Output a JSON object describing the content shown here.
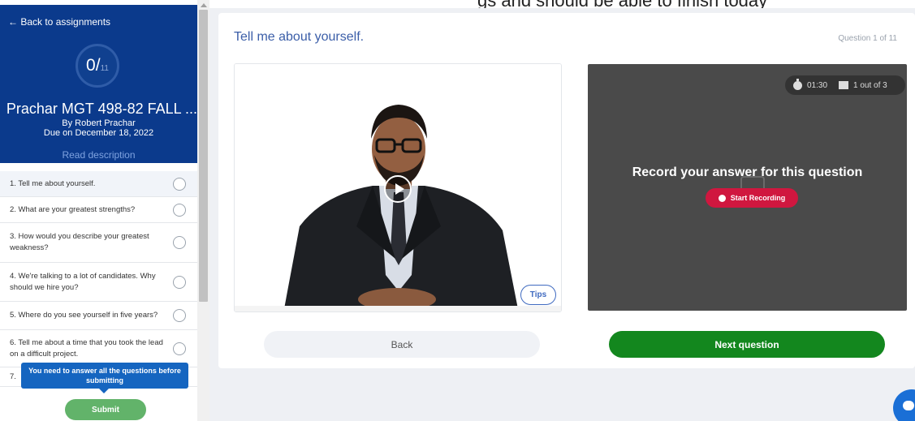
{
  "top_strip": {
    "partial_text": "gs and should be able to finish today"
  },
  "sidebar": {
    "back_link": "← Back to assignments",
    "progress": {
      "done": "0",
      "total": "11"
    },
    "course_title": "Prachar MGT 498-82 FALL ...",
    "author": "By Robert Prachar",
    "due": "Due on December 18, 2022",
    "read_description": "Read description",
    "questions": [
      {
        "label": "1. Tell me about yourself.",
        "active": true
      },
      {
        "label": "2. What are your greatest strengths?",
        "active": false
      },
      {
        "label": "3. How would you describe your greatest weakness?",
        "active": false
      },
      {
        "label": "4. We're talking to a lot of candidates. Why should we hire you?",
        "active": false
      },
      {
        "label": "5. Where do you see yourself in five years?",
        "active": false
      },
      {
        "label": "6. Tell me about a time that you took the lead on a difficult project.",
        "active": false
      },
      {
        "label": "7.",
        "active": false
      }
    ],
    "tooltip": "You need to answer all the questions before submitting",
    "submit_label": "Submit"
  },
  "main": {
    "question_title": "Tell me about yourself.",
    "question_count": "Question 1 of 11",
    "tips_label": "Tips",
    "timer": "01:30",
    "takes": "1 out of 3",
    "record_prompt": "Record your answer for this question",
    "start_recording_label": "Start Recording",
    "back_label": "Back",
    "next_label": "Next question"
  }
}
